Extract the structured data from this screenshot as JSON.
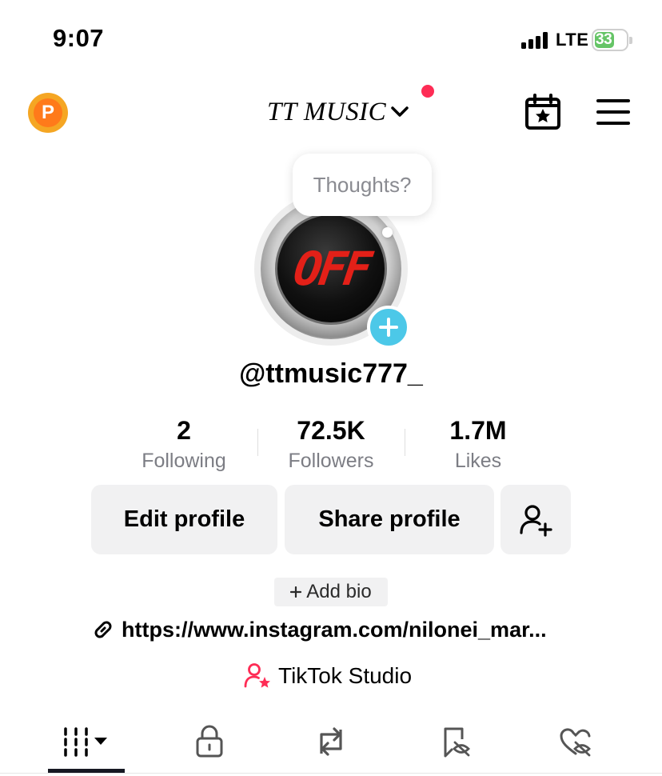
{
  "status_bar": {
    "time": "9:07",
    "network": "LTE",
    "battery": "33"
  },
  "header": {
    "account_name": "TT MUSIC",
    "coin_letter": "P"
  },
  "avatar": {
    "text": "OFF"
  },
  "thought_bubble": {
    "placeholder": "Thoughts?"
  },
  "profile": {
    "username": "@ttmusic777_"
  },
  "stats": [
    {
      "value": "2",
      "label": "Following"
    },
    {
      "value": "72.5K",
      "label": "Followers"
    },
    {
      "value": "1.7M",
      "label": "Likes"
    }
  ],
  "actions": {
    "edit_label": "Edit profile",
    "share_label": "Share profile"
  },
  "bio": {
    "add_label": "Add bio",
    "link": "https://www.instagram.com/nilonei_mar...",
    "studio_label": "TikTok Studio"
  },
  "tabs": [
    "videos-grid-icon",
    "lock-icon",
    "repost-icon",
    "favorites-icon",
    "liked-hidden-icon"
  ],
  "colors": {
    "accent_red": "#fe2c55",
    "avatar_add": "#4cc8e8",
    "coin": "#f5a623"
  }
}
